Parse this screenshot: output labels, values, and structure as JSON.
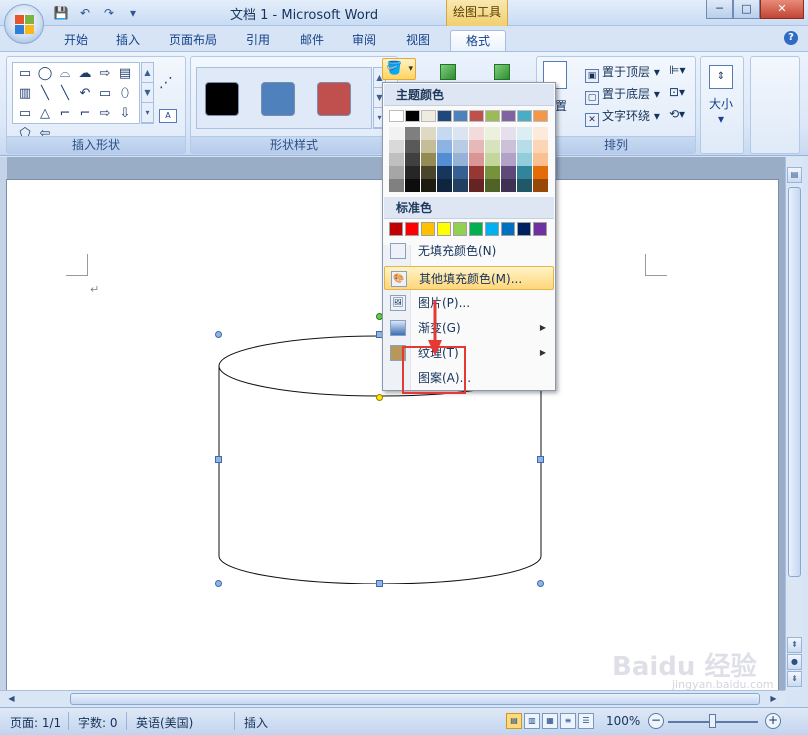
{
  "window": {
    "title": "文档 1 - Microsoft Word",
    "context_tab_title": "绘图工具",
    "minimize": "─",
    "maximize": "□",
    "close": "✕"
  },
  "quick_access": {
    "save_icon": "💾",
    "undo_icon": "↶",
    "redo_icon": "↷",
    "customize_icon": "▾"
  },
  "tabs": [
    {
      "label": "开始"
    },
    {
      "label": "插入"
    },
    {
      "label": "页面布局"
    },
    {
      "label": "引用"
    },
    {
      "label": "邮件"
    },
    {
      "label": "审阅"
    },
    {
      "label": "视图"
    },
    {
      "label": "格式",
      "active": true
    }
  ],
  "help": "?",
  "ribbon": {
    "insert_shapes_label": "插入形状",
    "shape_styles_label": "形状样式",
    "arrange_label": "排列",
    "shapes_gallery": [
      "▭",
      "◯",
      "⌓",
      "☁",
      "⇨",
      "▤",
      "▥",
      "╲",
      "╲",
      "↶",
      "▭",
      "⬯",
      "▭",
      "△",
      "⌐",
      "⌐",
      "⇨",
      "⇩",
      "⬠",
      "⇦"
    ],
    "style_swatches": [
      "#000000",
      "#4f81bd",
      "#c0504d"
    ],
    "bring_to_front": "置于顶层",
    "send_to_back": "置于底层",
    "text_wrapping": "文字环绕",
    "position_label": "置",
    "size_label": "大小"
  },
  "fill_menu": {
    "theme_colors_title": "主题颜色",
    "standard_colors_title": "标准色",
    "theme_top_row": [
      "#ffffff",
      "#000000",
      "#eeece1",
      "#1f497d",
      "#4f81bd",
      "#c0504d",
      "#9bbb59",
      "#8064a2",
      "#4bacc6",
      "#f79646"
    ],
    "theme_shades": [
      [
        "#f2f2f2",
        "#d9d9d9",
        "#bfbfbf",
        "#a6a6a6",
        "#808080"
      ],
      [
        "#7f7f7f",
        "#595959",
        "#404040",
        "#262626",
        "#0d0d0d"
      ],
      [
        "#ddd9c3",
        "#c4bd97",
        "#948a54",
        "#4a452a",
        "#1e1c11"
      ],
      [
        "#c6d9f1",
        "#8db3e2",
        "#548dd4",
        "#17365d",
        "#0f243e"
      ],
      [
        "#dbe5f1",
        "#b8cce4",
        "#95b3d7",
        "#366092",
        "#244061"
      ],
      [
        "#f2dcdb",
        "#e6b9b8",
        "#d99694",
        "#953734",
        "#632423"
      ],
      [
        "#ebf1dd",
        "#d7e3bc",
        "#c3d69b",
        "#76923c",
        "#4f6228"
      ],
      [
        "#e5e0ec",
        "#ccc1d9",
        "#b2a2c7",
        "#5f497a",
        "#3f3151"
      ],
      [
        "#dbeef3",
        "#b7dde8",
        "#92cddc",
        "#31859b",
        "#205867"
      ],
      [
        "#fdeada",
        "#fbd5b5",
        "#fac08f",
        "#e36c09",
        "#974806"
      ]
    ],
    "standard_colors": [
      "#c00000",
      "#ff0000",
      "#ffc000",
      "#ffff00",
      "#92d050",
      "#00b050",
      "#00b0f0",
      "#0070c0",
      "#002060",
      "#7030a0"
    ],
    "no_fill": "无填充颜色(N)",
    "more_fill": "其他填充颜色(M)...",
    "picture": "图片(P)...",
    "gradient": "渐变(G)",
    "texture": "纹理(T)",
    "pattern": "图案(A)..."
  },
  "status": {
    "page": "页面: 1/1",
    "words": "字数: 0",
    "language": "英语(美国)",
    "mode": "插入",
    "zoom": "100%"
  },
  "watermark": {
    "text": "Baidu 经验",
    "url": "jingyan.baidu.com"
  }
}
